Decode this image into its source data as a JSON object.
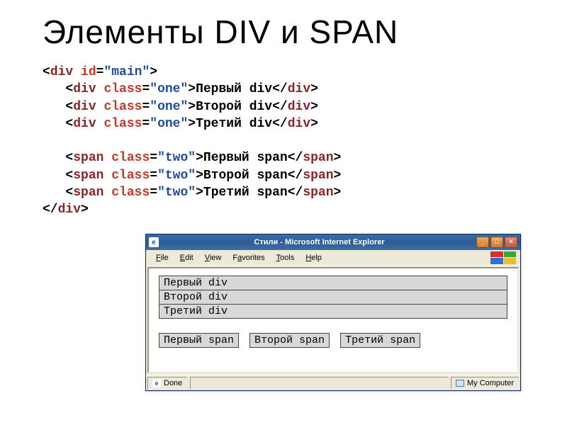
{
  "title": "Элементы DIV и SPAN",
  "code": {
    "line1_open": "<div id=\"main\">",
    "line2": "<div class=\"one\">Первый div</div>",
    "line3": "<div class=\"one\">Второй div</div>",
    "line4": "<div class=\"one\">Третий div</div>",
    "line5": "<span class=\"two\">Первый span</span>",
    "line6": "<span class=\"two\">Второй span</span>",
    "line7": "<span class=\"two\">Третий span</span>",
    "line8_close": "</div>"
  },
  "browser": {
    "titlebar": "Стили - Microsoft Internet Explorer",
    "menus": {
      "file": "File",
      "edit": "Edit",
      "view": "View",
      "favorites": "Favorites",
      "tools": "Tools",
      "help": "Help"
    },
    "content": {
      "divs": [
        "Первый div",
        "Второй div",
        "Третий div"
      ],
      "spans": [
        "Первый span",
        "Второй span",
        "Третий span"
      ]
    },
    "status_done": "Done",
    "status_zone": "My Computer"
  }
}
